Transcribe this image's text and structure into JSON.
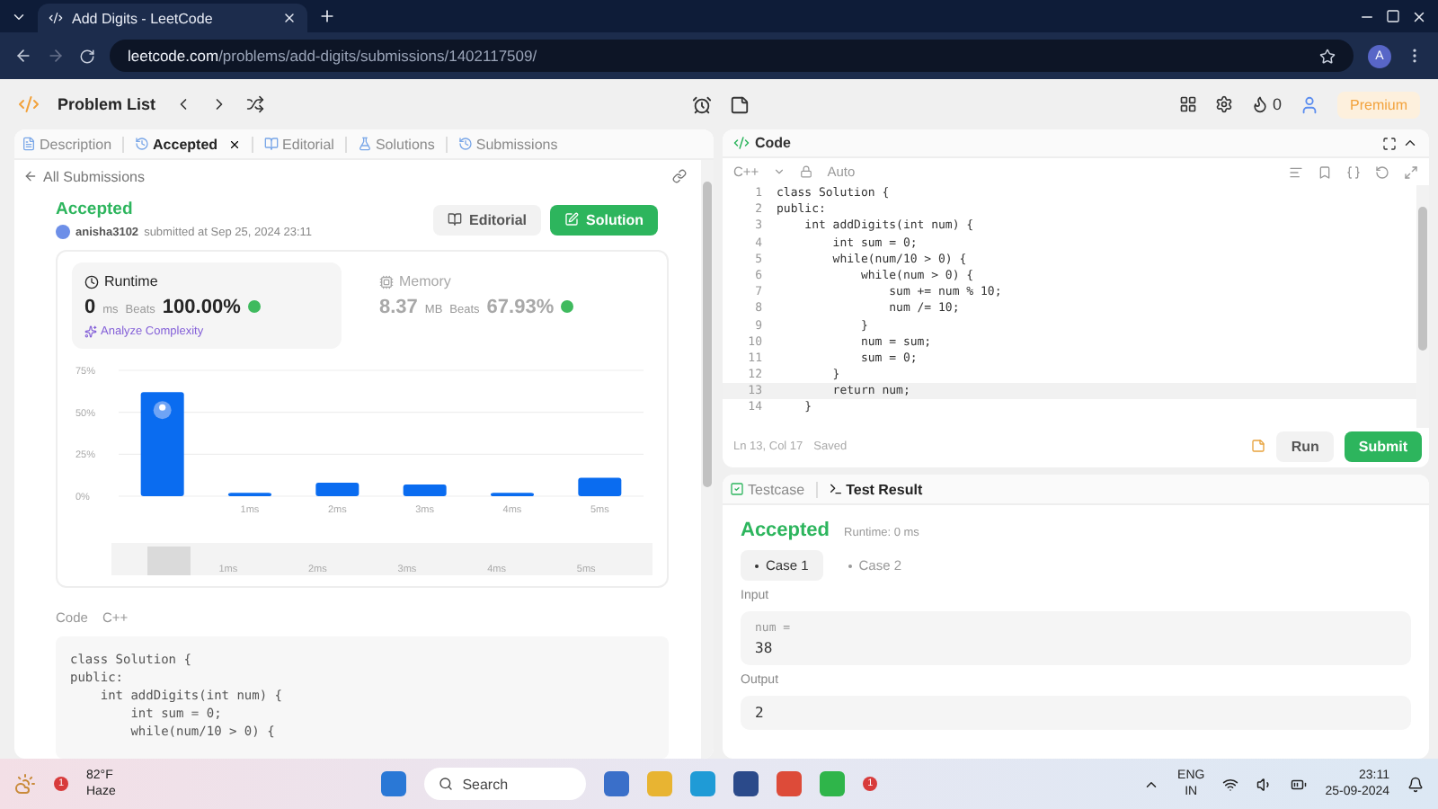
{
  "browser": {
    "tab_title": "Add Digits - LeetCode",
    "url_host": "leetcode.com",
    "url_path": "/problems/add-digits/submissions/1402117509/",
    "profile_initial": "A"
  },
  "nav": {
    "problem_list": "Problem List",
    "streak": "0",
    "premium": "Premium"
  },
  "left_tabs": [
    {
      "label": "Description",
      "selected": false,
      "closable": false
    },
    {
      "label": "Accepted",
      "selected": true,
      "closable": true
    },
    {
      "label": "Editorial",
      "selected": false,
      "closable": false
    },
    {
      "label": "Solutions",
      "selected": false,
      "closable": false
    },
    {
      "label": "Submissions",
      "selected": false,
      "closable": false
    }
  ],
  "back_link": "All Submissions",
  "submission": {
    "status": "Accepted",
    "user": "anisha3102",
    "submitted": "submitted at Sep 25, 2024 23:11",
    "editorial_button": "Editorial",
    "solution_button": "Solution"
  },
  "stats": [
    {
      "title": "Runtime",
      "value": "0",
      "unit": "ms",
      "beats_label": "Beats",
      "beats": "100.00%",
      "selected": true,
      "analyze": "Analyze Complexity"
    },
    {
      "title": "Memory",
      "value": "8.37",
      "unit": "MB",
      "beats_label": "Beats",
      "beats": "67.93%",
      "selected": false
    }
  ],
  "chart_data": {
    "type": "bar",
    "categories": [
      null,
      "1ms",
      "2ms",
      "3ms",
      "4ms",
      "5ms"
    ],
    "series": [
      {
        "color": "#0a6cf0",
        "values": [
          62,
          2,
          8,
          7,
          2,
          11
        ]
      }
    ],
    "ylim": [
      0,
      75
    ],
    "yticks": [
      {
        "value": 0,
        "label": "0%"
      },
      {
        "value": 25,
        "label": "25%"
      },
      {
        "value": 50,
        "label": "50%"
      },
      {
        "value": 75,
        "label": "75%"
      }
    ]
  },
  "range_labels": [
    "1ms",
    "2ms",
    "3ms",
    "4ms",
    "5ms"
  ],
  "left_code": {
    "label": "Code",
    "language": "C++",
    "lines": [
      "class Solution {",
      "public:",
      "    int addDigits(int num) {",
      "        int sum = 0;",
      "        while(num/10 > 0) {"
    ]
  },
  "editor": {
    "title": "Code",
    "language": "C++",
    "mode": "Auto",
    "lines": [
      {
        "number": "1",
        "text": "class Solution {",
        "current": false
      },
      {
        "number": "2",
        "text": "public:",
        "current": false
      },
      {
        "number": "3",
        "text": "    int addDigits(int num) {",
        "current": false
      },
      {
        "number": "4",
        "text": "        int sum = 0;",
        "current": false
      },
      {
        "number": "5",
        "text": "        while(num/10 > 0) {",
        "current": false
      },
      {
        "number": "6",
        "text": "            while(num > 0) {",
        "current": false
      },
      {
        "number": "7",
        "text": "                sum += num % 10;",
        "current": false
      },
      {
        "number": "8",
        "text": "                num /= 10;",
        "current": false
      },
      {
        "number": "9",
        "text": "            }",
        "current": false
      },
      {
        "number": "10",
        "text": "            num = sum;",
        "current": false
      },
      {
        "number": "11",
        "text": "            sum = 0;",
        "current": false
      },
      {
        "number": "12",
        "text": "        }",
        "current": false
      },
      {
        "number": "13",
        "text": "        return num;",
        "current": true
      },
      {
        "number": "14",
        "text": "    }",
        "current": false
      }
    ],
    "cursor": "Ln 13, Col 17",
    "saved": "Saved",
    "run": "Run",
    "submit": "Submit"
  },
  "test_tabs": [
    {
      "label": "Testcase",
      "selected": false
    },
    {
      "label": "Test Result",
      "selected": true
    }
  ],
  "result": {
    "status": "Accepted",
    "runtime": "Runtime: 0 ms",
    "cases": [
      {
        "label": "Case 1",
        "selected": true
      },
      {
        "label": "Case 2",
        "selected": false
      }
    ],
    "input_label": "Input",
    "input_name": "num =",
    "input_value": "38",
    "output_label": "Output",
    "output_value": "2"
  },
  "taskbar": {
    "temperature": "82°F",
    "weather": "Haze",
    "weather_badge": "1",
    "search": "Search",
    "whatsapp_badge": "1",
    "lang": "ENG",
    "region": "IN",
    "time": "23:11",
    "date": "25-09-2024"
  }
}
